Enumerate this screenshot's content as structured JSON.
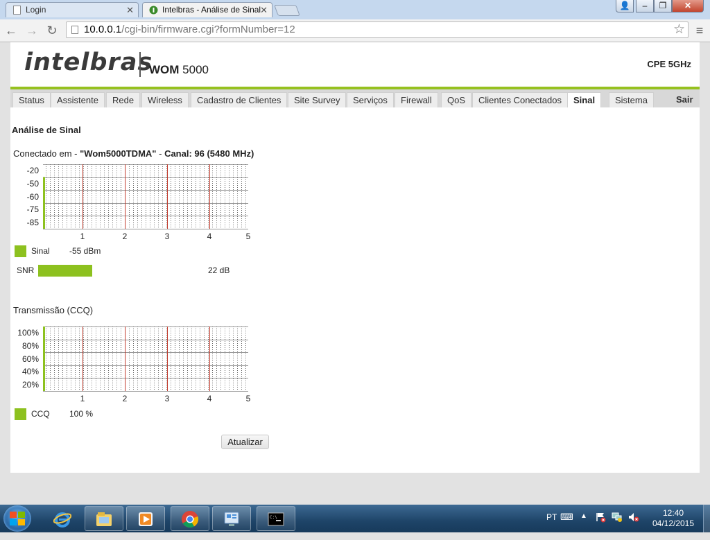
{
  "browser": {
    "tabs": [
      {
        "title": "Login",
        "active": false
      },
      {
        "title": "Intelbras - Análise de Sinal",
        "active": true
      }
    ],
    "address": {
      "host": "10.0.0.1",
      "path": "/cgi-bin/firmware.cgi?formNumber=12"
    },
    "colors": {
      "chrome": "#c5d8ee",
      "toolbar": "#f2f2f2"
    }
  },
  "header": {
    "logo_text": "intelbras",
    "model_bold": "WOM",
    "model_rest": "5000",
    "device_type": "CPE 5GHz"
  },
  "nav": {
    "items": [
      "Status",
      "Assistente",
      "Rede",
      "Wireless",
      "Cadastro de Clientes",
      "Site Survey",
      "Serviços",
      "Firewall",
      "QoS",
      "Clientes Conectados",
      "Sinal",
      "Sistema"
    ],
    "active": "Sinal",
    "logout": "Sair",
    "accent_color": "#96c11f"
  },
  "main": {
    "title": "Análise de Sinal",
    "connection": {
      "prefix": "Conectado em -",
      "ssid": "\"Wom5000TDMA\"",
      "separator": "-",
      "channel": "Canal: 96 (5480 MHz)"
    },
    "signal_legend": {
      "label": "Sinal",
      "value": "-55 dBm"
    },
    "snr": {
      "label": "SNR",
      "value": "22 dB",
      "fill_fraction": 0.29
    },
    "ccq_title": "Transmissão (CCQ)",
    "ccq_legend": {
      "label": "CCQ",
      "value": "100 %"
    },
    "update_button": "Atualizar"
  },
  "chart_data": [
    {
      "type": "bar",
      "ytick_labels": [
        "-20",
        "-50",
        "-60",
        "-75",
        "-85"
      ],
      "xtick_labels": [
        "1",
        "2",
        "3",
        "4",
        "5"
      ],
      "series": [
        {
          "name": "Sinal",
          "values": [
            -55
          ]
        }
      ],
      "grid": true,
      "bar_color": "#8dc11f",
      "major_line_color": "#c0392b"
    },
    {
      "type": "bar",
      "ytick_labels": [
        "100%",
        "80%",
        "60%",
        "40%",
        "20%"
      ],
      "xtick_labels": [
        "1",
        "2",
        "3",
        "4",
        "5"
      ],
      "series": [
        {
          "name": "CCQ",
          "values": [
            100
          ]
        }
      ],
      "grid": true,
      "bar_color": "#8dc11f",
      "major_line_color": "#c0392b"
    }
  ],
  "taskbar": {
    "language": "PT",
    "time": "12:40",
    "date": "04/12/2015",
    "apps": [
      "internet-explorer-icon",
      "file-explorer-icon",
      "media-player-icon",
      "chrome-icon",
      "control-panel-icon",
      "command-prompt-icon"
    ]
  }
}
